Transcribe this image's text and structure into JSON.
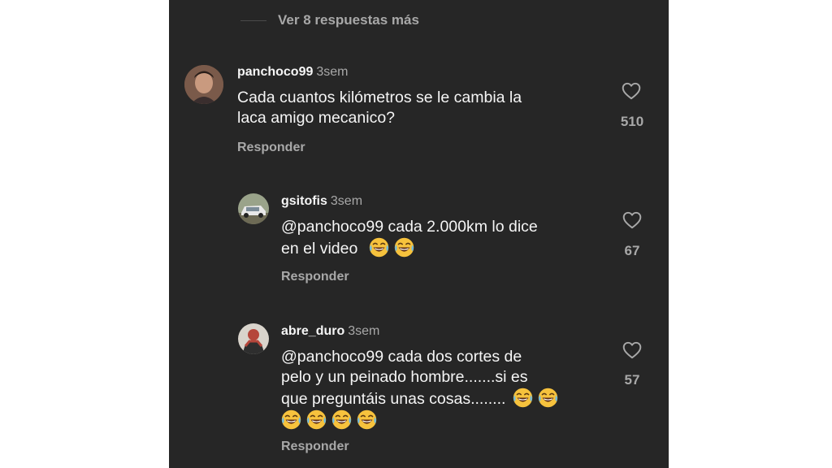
{
  "thread": {
    "more_replies": "Ver 8 respuestas más"
  },
  "comments": [
    {
      "username": "panchoco99",
      "time": "3sem",
      "line1": "Cada cuantos kilómetros se le cambia la",
      "line2": "laca amigo mecanico?",
      "reply_label": "Responder",
      "likes": "510",
      "icon": "heart-outline-icon"
    },
    {
      "username": "gsitofis",
      "time": "3sem",
      "line1": "@panchoco99 cada 2.000km lo dice",
      "line2": "en el video",
      "emoji_line2_count": 2,
      "reply_label": "Responder",
      "likes": "67",
      "icon": "heart-outline-icon"
    },
    {
      "username": "abre_duro",
      "time": "3sem",
      "line1": "@panchoco99 cada dos cortes de",
      "line2": "pelo y un peinado hombre.......si es",
      "line3": "que preguntáis unas cosas........",
      "emoji_line3_count": 2,
      "emoji_line4_count": 4,
      "reply_label": "Responder",
      "likes": "57",
      "icon": "heart-outline-icon"
    }
  ],
  "colors": {
    "panel_bg": "#262626",
    "text": "#f5f5f5",
    "muted": "#a8a8a8"
  },
  "emoji_name": "face-with-tears-of-joy-icon"
}
